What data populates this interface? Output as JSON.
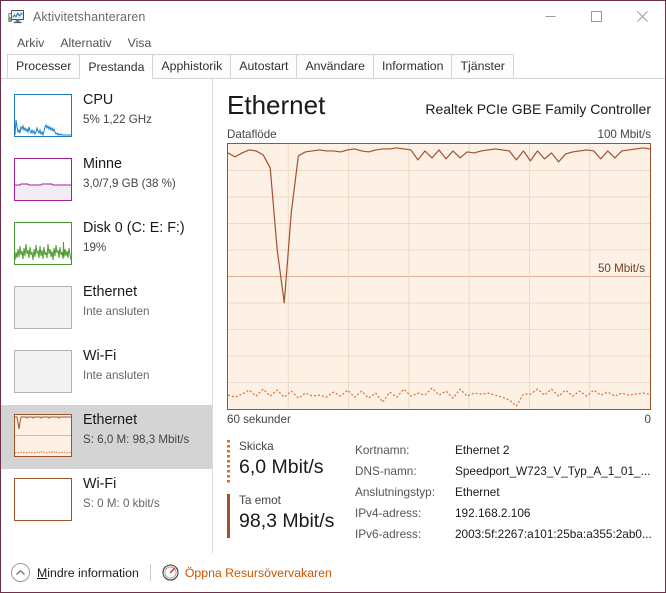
{
  "window": {
    "title": "Aktivitetshanteraren",
    "icon": "task-manager-icon",
    "minimize": "—",
    "maximize": "☐",
    "close": "✕"
  },
  "menu": {
    "items": [
      {
        "label": "Arkiv"
      },
      {
        "label": "Alternativ"
      },
      {
        "label": "Visa"
      }
    ]
  },
  "tabs": [
    {
      "label": "Processer",
      "active": false
    },
    {
      "label": "Prestanda",
      "active": true
    },
    {
      "label": "Apphistorik",
      "active": false
    },
    {
      "label": "Autostart",
      "active": false
    },
    {
      "label": "Användare",
      "active": false
    },
    {
      "label": "Information",
      "active": false
    },
    {
      "label": "Tjänster",
      "active": false
    }
  ],
  "sidebar": {
    "items": [
      {
        "title": "CPU",
        "sub": "5%  1,22 GHz",
        "color": "#1a7dc4",
        "selected": false
      },
      {
        "title": "Minne",
        "sub": "3,0/7,9 GB (38 %)",
        "color": "#a020a0",
        "selected": false
      },
      {
        "title": "Disk 0 (C: E: F:)",
        "sub": "19%",
        "color": "#4a9b2f",
        "selected": false
      },
      {
        "title": "Ethernet",
        "sub": "Inte ansluten",
        "color": "#b4b4b4",
        "selected": false
      },
      {
        "title": "Wi-Fi",
        "sub": "Inte ansluten",
        "color": "#b4b4b4",
        "selected": false
      },
      {
        "title": "Ethernet",
        "sub": "S: 6,0 M: 98,3 Mbit/s",
        "color": "#a0522d",
        "selected": true
      },
      {
        "title": "Wi-Fi",
        "sub": "S: 0 M: 0 kbit/s",
        "color": "#a0522d",
        "selected": false
      }
    ]
  },
  "main": {
    "title": "Ethernet",
    "adapter": "Realtek PCIe GBE Family Controller",
    "graph_label": "Dataflöde",
    "graph_max": "100 Mbit/s",
    "graph_mid": "50 Mbit/s",
    "axis_left": "60 sekunder",
    "axis_right": "0",
    "send": {
      "label": "Skicka",
      "value": "6,0 Mbit/s"
    },
    "receive": {
      "label": "Ta emot",
      "value": "98,3 Mbit/s"
    },
    "info": [
      {
        "key": "Kortnamn:",
        "value": "Ethernet 2"
      },
      {
        "key": "DNS-namn:",
        "value": "Speedport_W723_V_Typ_A_1_01_..."
      },
      {
        "key": "Anslutningstyp:",
        "value": "Ethernet"
      },
      {
        "key": "IPv4-adress:",
        "value": "192.168.2.106"
      },
      {
        "key": "IPv6-adress:",
        "value": "2003:5f:2267:a101:25ba:a355:2ab0..."
      }
    ]
  },
  "footer": {
    "less_info": "Mindre information",
    "less_info_accel": "M",
    "less_info_rest": "indre information",
    "resource_monitor": "Öppna Resursövervakaren"
  },
  "colors": {
    "accent": "#a0522d",
    "send_line": "#e06a28",
    "receive_line": "#a0522d",
    "graph_fill": "#fdf1e6",
    "link": "#cc5500"
  },
  "chart_data": {
    "type": "area",
    "title": "Dataflöde",
    "ylabel": "Mbit/s",
    "xlabel": "60 sekunder",
    "ylim": [
      0,
      100
    ],
    "xlim": [
      60,
      0
    ],
    "grid": true,
    "series": [
      {
        "name": "Ta emot",
        "color": "#a0522d",
        "style": "solid",
        "current": 98.3,
        "values": [
          96.5,
          95.2,
          96.8,
          97.6,
          97.2,
          96.0,
          91.0,
          60.0,
          40.0,
          74.0,
          95.5,
          97.0,
          97.4,
          97.6,
          97.2,
          97.4,
          97.0,
          97.6,
          97.8,
          97.4,
          97.0,
          97.6,
          98.0,
          98.2,
          98.4,
          98.0,
          97.6,
          94.0,
          97.2,
          94.6,
          97.6,
          94.4,
          97.2,
          94.8,
          97.0,
          96.8,
          97.4,
          97.8,
          98.0,
          97.8,
          97.4,
          94.0,
          97.4,
          93.8,
          97.4,
          94.2,
          96.8,
          93.4,
          96.4,
          97.0,
          97.4,
          97.8,
          97.4,
          94.2,
          97.4,
          94.6,
          97.2,
          97.6,
          97.8,
          98.3
        ]
      },
      {
        "name": "Skicka",
        "color": "#e06a28",
        "style": "dotted",
        "current": 6.0,
        "values": [
          5.2,
          4.4,
          5.6,
          7.0,
          4.8,
          7.4,
          5.0,
          7.2,
          4.6,
          6.8,
          4.4,
          6.2,
          4.8,
          5.4,
          4.6,
          6.4,
          4.8,
          7.0,
          4.6,
          6.6,
          4.2,
          6.0,
          2.6,
          6.4,
          4.4,
          7.6,
          4.6,
          6.2,
          5.2,
          7.8,
          5.4,
          6.8,
          4.4,
          7.4,
          5.0,
          6.0,
          5.6,
          6.2,
          5.4,
          4.6,
          3.4,
          1.0,
          5.6,
          5.8,
          7.4,
          5.2,
          7.6,
          5.0,
          7.2,
          4.8,
          6.8,
          5.0,
          7.0,
          5.2,
          6.4,
          5.0,
          6.0,
          5.4,
          6.2,
          6.0
        ]
      }
    ]
  }
}
